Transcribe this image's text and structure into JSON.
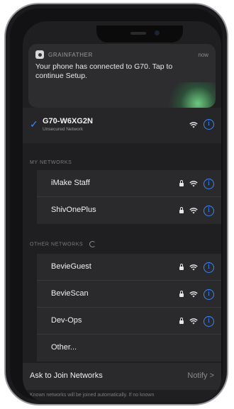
{
  "notification": {
    "app_name": "GRAINFATHER",
    "time": "now",
    "body": "Your phone has connected to G70. Tap to continue Setup."
  },
  "current_network": {
    "ssid": "G70-W6XG2N",
    "subtitle": "Unsecured Network"
  },
  "my_networks": {
    "header": "MY NETWORKS",
    "items": [
      {
        "name": "iMake Staff"
      },
      {
        "name": "ShivOnePlus"
      }
    ]
  },
  "other_networks": {
    "header": "OTHER NETWORKS",
    "items": [
      {
        "name": "BevieGuest"
      },
      {
        "name": "BevieScan"
      },
      {
        "name": "Dev-Ops"
      }
    ],
    "other_label": "Other..."
  },
  "ask_to_join": {
    "label": "Ask to Join Networks",
    "value": "Notify",
    "chevron": ">"
  },
  "footnote": "Known networks will be joined automatically. If no known",
  "colors": {
    "accent": "#3a86ff",
    "background": "#1f1f22",
    "row": "#2a2a2d"
  }
}
